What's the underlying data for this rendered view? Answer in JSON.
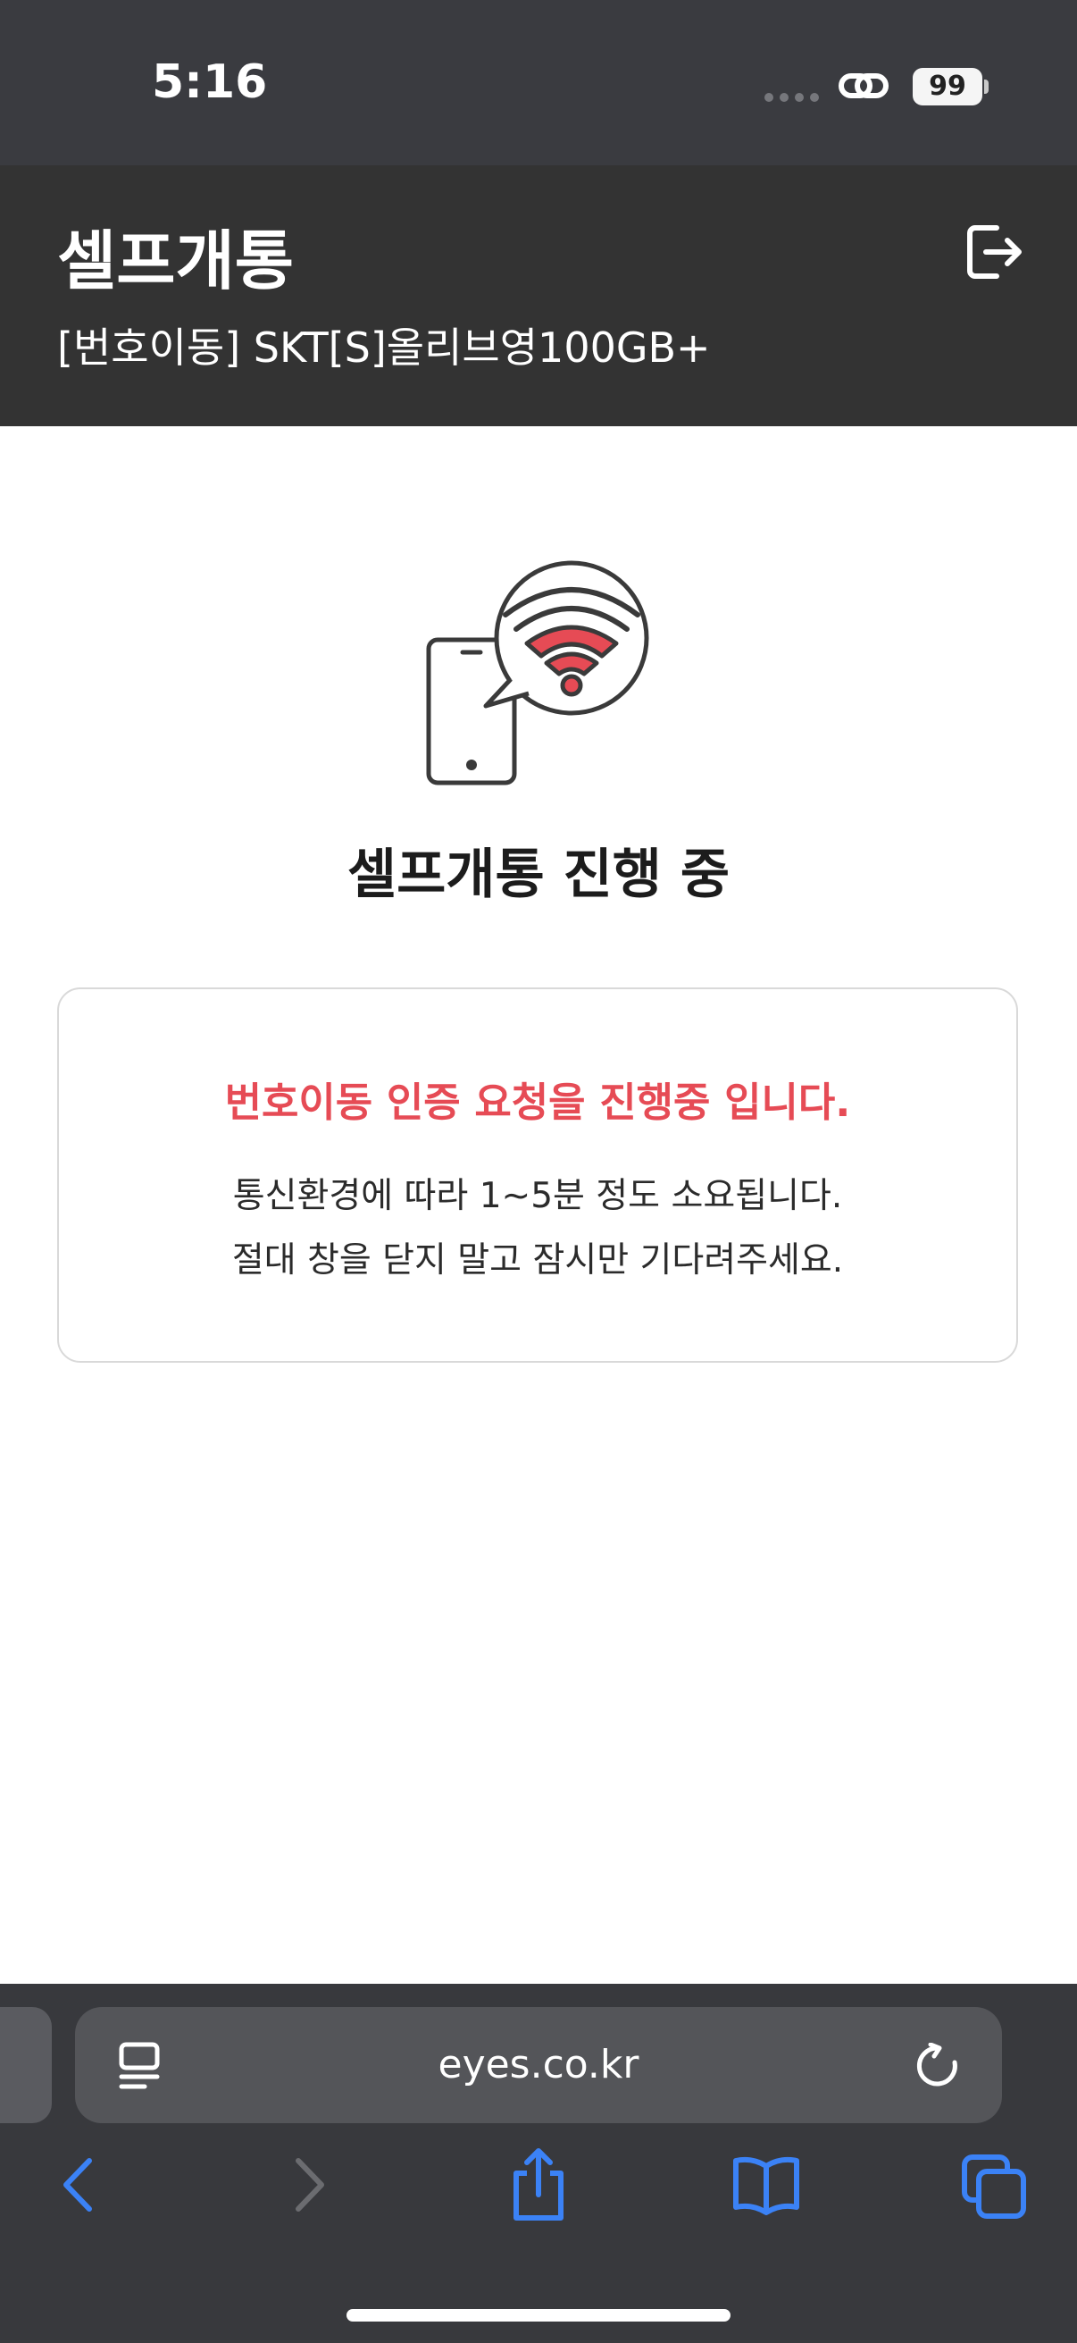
{
  "status_bar": {
    "time": "5:16",
    "battery_level": "99",
    "icons": [
      "signal-dots-icon",
      "link-icon",
      "battery-icon"
    ]
  },
  "header": {
    "title": "셀프개통",
    "plan_name": "[번호이동] SKT[S]올리브영100GB+",
    "icons": [
      "logout-icon"
    ]
  },
  "main": {
    "hero_icon": "phone-wifi-icon",
    "status_title": "셀프개통 진행 중",
    "card": {
      "headline": "번호이동 인증 요청을 진행중 입니다.",
      "line1": "통신환경에 따라 1~5분 정도 소요됩니다.",
      "line2": "절대 창을 닫지 말고 잠시만 기다려주세요."
    }
  },
  "browser": {
    "url": "eyes.co.kr",
    "toolbar_icons": [
      "back-icon",
      "forward-icon",
      "share-icon",
      "bookmarks-icon",
      "tabs-icon"
    ]
  },
  "colors": {
    "header_bg": "#333333",
    "accent_red": "#e64b55",
    "browser_bg": "#38393d",
    "ios_blue": "#3b82f6"
  }
}
